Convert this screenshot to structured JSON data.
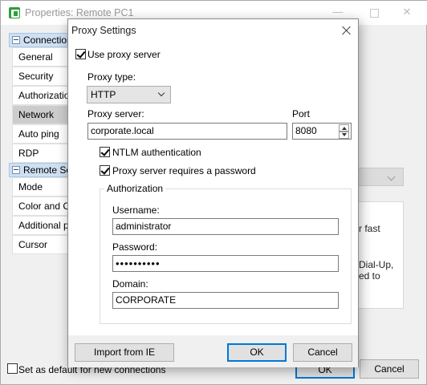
{
  "background": {
    "title": "Properties: Remote PC1",
    "groups": [
      {
        "label": "Connection",
        "items": [
          "General",
          "Security",
          "Authorization",
          "Network",
          "Auto ping",
          "RDP"
        ]
      },
      {
        "label": "Remote Scre",
        "items": [
          "Mode",
          "Color and CPU",
          "Additional pro",
          "Cursor"
        ]
      }
    ],
    "selected_item": "Network",
    "partial_text": [
      "r fast",
      "Dial-Up,",
      "ed to"
    ],
    "set_default_label": "Set as default for new connections",
    "ok_label": "OK",
    "cancel_label": "Cancel"
  },
  "dialog": {
    "title": "Proxy Settings",
    "use_proxy_label": "Use proxy server",
    "use_proxy_checked": true,
    "proxy_type_label": "Proxy type:",
    "proxy_type_value": "HTTP",
    "proxy_server_label": "Proxy server:",
    "proxy_server_value": "corporate.local",
    "port_label": "Port",
    "port_value": "8080",
    "ntlm_label": "NTLM authentication",
    "ntlm_checked": true,
    "requires_password_label": "Proxy server requires a password",
    "requires_password_checked": true,
    "auth_group_label": "Authorization",
    "username_label": "Username:",
    "username_value": "administrator",
    "password_label": "Password:",
    "password_value": "••••••••••",
    "domain_label": "Domain:",
    "domain_value": "CORPORATE",
    "import_button": "Import from IE",
    "ok_button": "OK",
    "cancel_button": "Cancel"
  },
  "colors": {
    "selection_blue": "#0078d7",
    "group_header": "#cfe0f3",
    "selected_item_bg": "#cccccc",
    "app_icon_green": "#2e9e3c"
  },
  "icons": [
    "app-icon",
    "minimize-icon",
    "maximize-icon",
    "close-icon",
    "collapse-icon",
    "chevron-down-icon",
    "checkmark-icon",
    "spin-up-icon",
    "spin-down-icon"
  ]
}
